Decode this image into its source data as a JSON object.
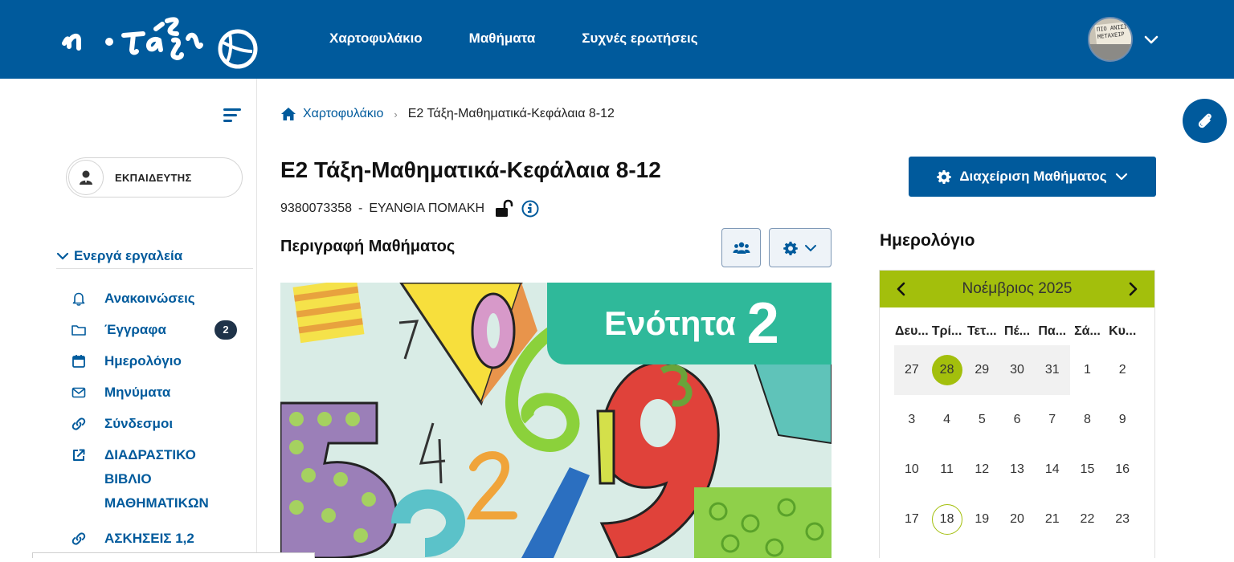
{
  "header": {
    "logo_text": "η τάξη",
    "nav": [
      "Χαρτοφυλάκιο",
      "Μαθήματα",
      "Συχνές ερωτήσεις"
    ],
    "avatar_text": "ΠΙΟ ΑΝΙΣΙ ΜΕΤΑΧΕΙΡ"
  },
  "sidebar": {
    "role": "ΕΚΠΑΙΔΕΥΤΗΣ",
    "tools_heading": "Ενεργά εργαλεία",
    "tools": [
      {
        "label": "Ανακοινώσεις",
        "icon": "bell-icon"
      },
      {
        "label": "Έγγραφα",
        "icon": "folder-icon",
        "badge": "2"
      },
      {
        "label": "Ημερολόγιο",
        "icon": "calendar-icon"
      },
      {
        "label": "Μηνύματα",
        "icon": "envelope-icon"
      },
      {
        "label": "Σύνδεσμοι",
        "icon": "link-icon"
      },
      {
        "label": "ΔΙΑΔΡΑΣΤΙΚΟ ΒΙΒΛΙΟ ΜΑΘΗΜΑΤΙΚΩΝ",
        "lines": [
          "ΔΙΑΔΡΑΣΤΙΚΟ",
          "ΒΙΒΛΙΟ",
          "ΜΑΘΗΜΑΤΙΚΩΝ"
        ],
        "icon": "external-link-icon"
      },
      {
        "label": "ΑΣΚΗΣΕΙΣ 1,2",
        "icon": "link-icon"
      }
    ]
  },
  "breadcrumb": {
    "home": "Χαρτοφυλάκιο",
    "current": "Ε2 Τάξη-Μαθηματικά-Κεφάλαια 8-12"
  },
  "course": {
    "title": "Ε2 Τάξη-Μαθηματικά-Κεφάλαια 8-12",
    "code": "9380073358",
    "sep": "-",
    "teacher": "ΕΥΑΝΘΙΑ ΠΟΜΑΚΗ",
    "manage_label": "Διαχείριση Μαθήματος",
    "description_heading": "Περιγραφή Μαθήματος",
    "image_banner_word": "Ενότητα",
    "image_banner_number": "2",
    "image_digits": [
      "0",
      "6",
      "7",
      "3",
      "1",
      "9",
      "4",
      "2",
      "5"
    ]
  },
  "calendar": {
    "title": "Ημερολόγιο",
    "month": "Νοέμβριος 2025",
    "weekdays": [
      "Δευ...",
      "Τρί...",
      "Τετ...",
      "Πέ...",
      "Πα...",
      "Σά...",
      "Κυ..."
    ],
    "weeks": [
      [
        "27",
        "28",
        "29",
        "30",
        "31",
        "1",
        "2"
      ],
      [
        "3",
        "4",
        "5",
        "6",
        "7",
        "8",
        "9"
      ],
      [
        "10",
        "11",
        "12",
        "13",
        "14",
        "15",
        "16"
      ],
      [
        "17",
        "18",
        "19",
        "20",
        "21",
        "22",
        "23"
      ]
    ],
    "selected": "28",
    "today": "18",
    "accent": "#a3bf0c"
  },
  "colors": {
    "brand": "#005a9c",
    "badge": "#1f3349",
    "banner": "#2fb99a"
  }
}
